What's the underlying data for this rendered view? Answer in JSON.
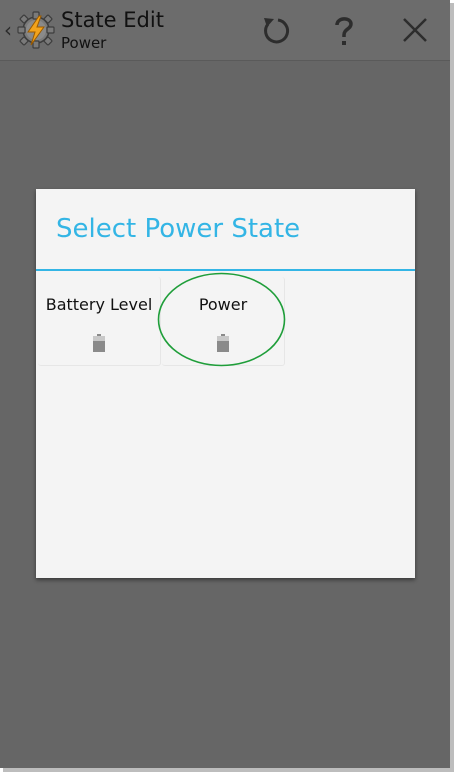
{
  "action_bar": {
    "title": "State Edit",
    "subtitle": "Power",
    "buttons": [
      {
        "icon": "undo-icon"
      },
      {
        "icon": "help-icon"
      },
      {
        "icon": "close-icon"
      }
    ]
  },
  "dialog": {
    "title": "Select Power State",
    "items": [
      {
        "label": "Battery Level",
        "icon": "battery-icon"
      },
      {
        "label": "Power",
        "icon": "battery-icon"
      }
    ]
  },
  "colors": {
    "accent": "#33b5e5",
    "highlight_circle": "#1f9e3a",
    "screen_bg": "#666666",
    "dialog_bg": "#f4f4f4"
  }
}
